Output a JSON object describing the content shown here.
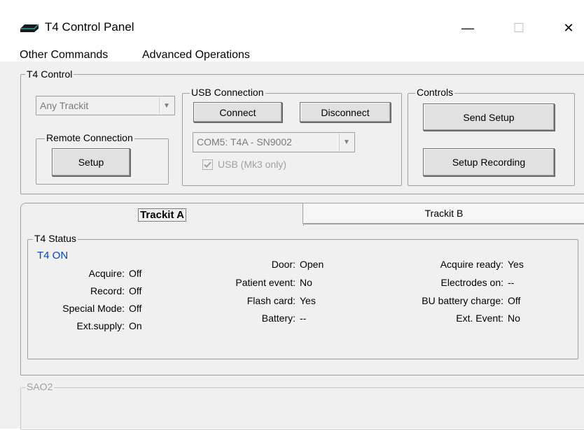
{
  "window": {
    "title": "T4 Control Panel",
    "minimize": "—",
    "maximize": "☐",
    "close": "✕"
  },
  "menu": {
    "items": [
      "Other Commands",
      "Advanced Operations"
    ]
  },
  "t4_control": {
    "legend": "T4 Control",
    "device_select": {
      "value": "Any Trackit"
    },
    "remote": {
      "legend": "Remote Connection",
      "setup_label": "Setup"
    },
    "usb": {
      "legend": "USB Connection",
      "connect_label": "Connect",
      "disconnect_label": "Disconnect",
      "port_value": "COM5: T4A - SN9002",
      "usb_checkbox_label": "USB (Mk3 only)",
      "usb_checkbox_checked": true
    },
    "controls": {
      "legend": "Controls",
      "send_setup_label": "Send Setup",
      "setup_recording_label": "Setup Recording"
    }
  },
  "tabs": [
    {
      "label": "Trackit A",
      "active": true
    },
    {
      "label": "Trackit B",
      "active": false
    }
  ],
  "t4_status": {
    "legend": "T4 Status",
    "state": "T4 ON",
    "state_color": "#0044cc",
    "col1": [
      {
        "label": "Acquire:",
        "value": "Off"
      },
      {
        "label": "Record:",
        "value": "Off"
      },
      {
        "label": "Special Mode:",
        "value": "Off"
      },
      {
        "label": "Ext.supply:",
        "value": "On"
      }
    ],
    "col2": [
      {
        "label": "Door:",
        "value": "Open"
      },
      {
        "label": "Patient event:",
        "value": "No"
      },
      {
        "label": "Flash card:",
        "value": "Yes"
      },
      {
        "label": "Battery:",
        "value": "--"
      }
    ],
    "col3": [
      {
        "label": "Acquire ready:",
        "value": "Yes"
      },
      {
        "label": "Electrodes on:",
        "value": "--"
      },
      {
        "label": "BU battery charge:",
        "value": "Off"
      },
      {
        "label": "Ext. Event:",
        "value": "No"
      }
    ]
  },
  "sao2": {
    "legend": "SAO2"
  }
}
